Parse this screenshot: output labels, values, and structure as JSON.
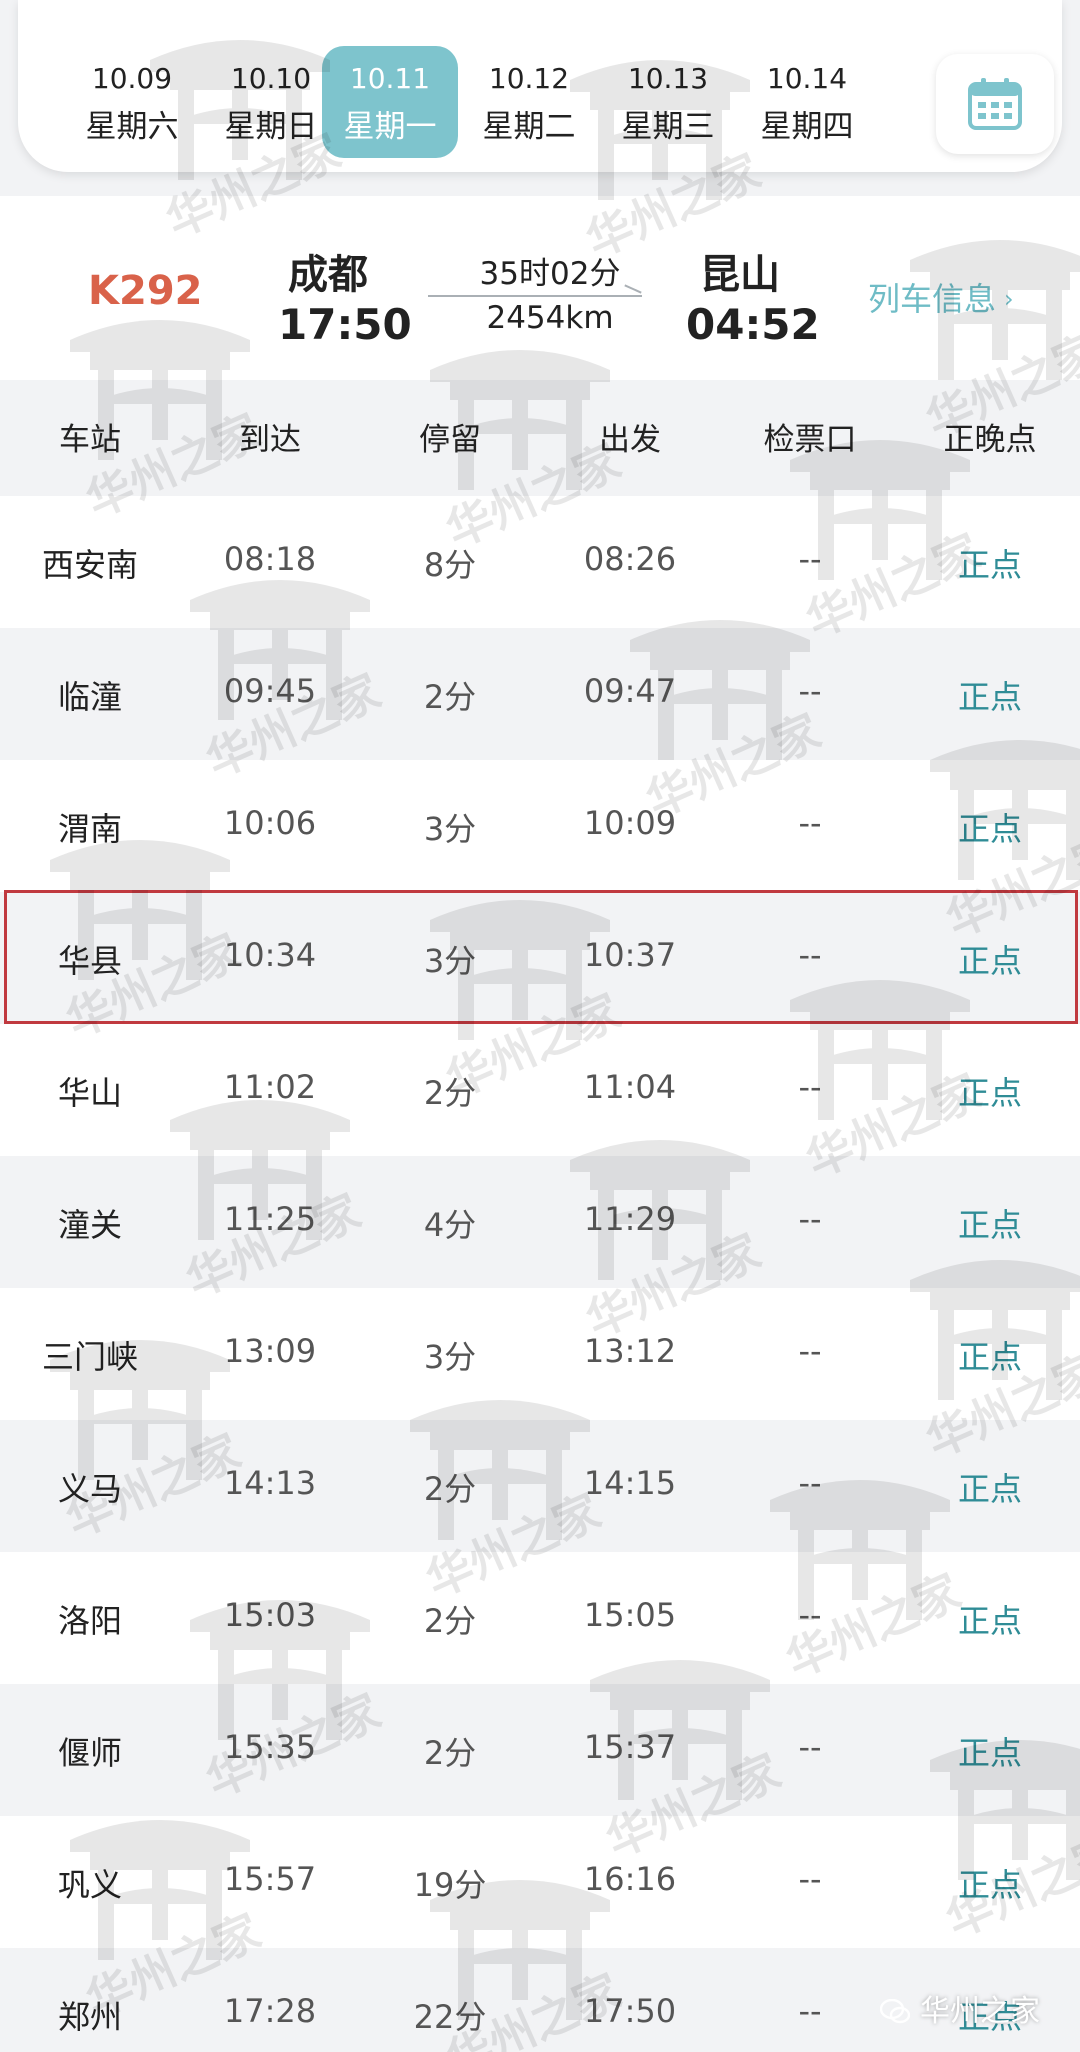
{
  "date_bar": {
    "tabs": [
      {
        "date": "10.09",
        "weekday": "星期六",
        "active": false
      },
      {
        "date": "10.10",
        "weekday": "星期日",
        "active": false
      },
      {
        "date": "10.11",
        "weekday": "星期一",
        "active": true
      },
      {
        "date": "10.12",
        "weekday": "星期二",
        "active": false
      },
      {
        "date": "10.13",
        "weekday": "星期三",
        "active": false
      },
      {
        "date": "10.14",
        "weekday": "星期四",
        "active": false
      }
    ],
    "calendar_icon": "calendar-icon"
  },
  "train": {
    "number": "K292",
    "from_station": "成都",
    "from_time": "17:50",
    "to_station": "昆山",
    "to_time": "04:52",
    "duration": "35时02分",
    "distance": "2454km",
    "info_link": "列车信息",
    "info_chevron": "›"
  },
  "table": {
    "headers": {
      "station": "车站",
      "arrive": "到达",
      "stop": "停留",
      "depart": "出发",
      "gate": "检票口",
      "status": "正晚点"
    },
    "rows": [
      {
        "station": "西安南",
        "arrive": "08:18",
        "stop": "8分",
        "depart": "08:26",
        "gate": "--",
        "status": "正点"
      },
      {
        "station": "临潼",
        "arrive": "09:45",
        "stop": "2分",
        "depart": "09:47",
        "gate": "--",
        "status": "正点"
      },
      {
        "station": "渭南",
        "arrive": "10:06",
        "stop": "3分",
        "depart": "10:09",
        "gate": "--",
        "status": "正点"
      },
      {
        "station": "华县",
        "arrive": "10:34",
        "stop": "3分",
        "depart": "10:37",
        "gate": "--",
        "status": "正点"
      },
      {
        "station": "华山",
        "arrive": "11:02",
        "stop": "2分",
        "depart": "11:04",
        "gate": "--",
        "status": "正点"
      },
      {
        "station": "潼关",
        "arrive": "11:25",
        "stop": "4分",
        "depart": "11:29",
        "gate": "--",
        "status": "正点"
      },
      {
        "station": "三门峡",
        "arrive": "13:09",
        "stop": "3分",
        "depart": "13:12",
        "gate": "--",
        "status": "正点"
      },
      {
        "station": "义马",
        "arrive": "14:13",
        "stop": "2分",
        "depart": "14:15",
        "gate": "--",
        "status": "正点"
      },
      {
        "station": "洛阳",
        "arrive": "15:03",
        "stop": "2分",
        "depart": "15:05",
        "gate": "--",
        "status": "正点"
      },
      {
        "station": "偃师",
        "arrive": "15:35",
        "stop": "2分",
        "depart": "15:37",
        "gate": "--",
        "status": "正点"
      },
      {
        "station": "巩义",
        "arrive": "15:57",
        "stop": "19分",
        "depart": "16:16",
        "gate": "--",
        "status": "正点"
      },
      {
        "station": "郑州",
        "arrive": "17:28",
        "stop": "22分",
        "depart": "17:50",
        "gate": "--",
        "status": "正点"
      }
    ],
    "highlighted_station": "华县"
  },
  "watermark": {
    "text": "华州之家",
    "source_label": "华州之家"
  },
  "colors": {
    "accent": "#7ec4cd",
    "train_number": "#d9624a",
    "status": "#2f8c96",
    "highlight_border": "#c0393f"
  }
}
